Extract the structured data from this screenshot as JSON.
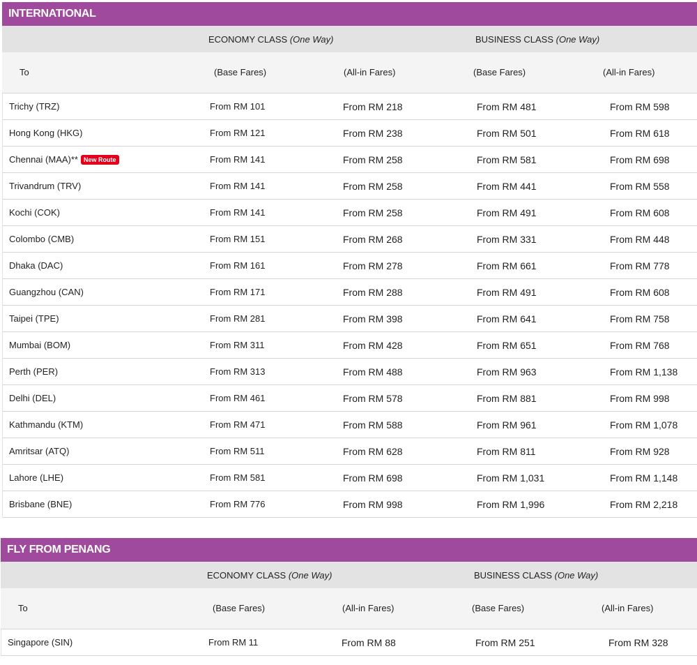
{
  "international": {
    "title": "INTERNATIONAL",
    "economy_label": "ECONOMY CLASS",
    "business_label": "BUSINESS CLASS",
    "one_way": "(One Way)",
    "col_to": "To",
    "col_base": "(Base Fares)",
    "col_allin": "(All-in Fares)",
    "rows": [
      {
        "dest": "Trichy (TRZ)",
        "eco_base": "From RM 101",
        "eco_allin": "From RM 218",
        "bus_base": "From RM 481",
        "bus_allin": "From RM 598"
      },
      {
        "dest": "Hong Kong (HKG)",
        "eco_base": "From RM 121",
        "eco_allin": "From RM 238",
        "bus_base": "From RM 501",
        "bus_allin": "From RM 618"
      },
      {
        "dest": "Chennai (MAA)**",
        "badge": "New Route",
        "eco_base": "From RM 141",
        "eco_allin": "From RM 258",
        "bus_base": "From RM 581",
        "bus_allin": "From RM 698"
      },
      {
        "dest": "Trivandrum (TRV)",
        "eco_base": "From RM 141",
        "eco_allin": "From RM 258",
        "bus_base": "From RM 441",
        "bus_allin": "From RM 558"
      },
      {
        "dest": "Kochi (COK)",
        "eco_base": "From RM 141",
        "eco_allin": "From RM 258",
        "bus_base": "From RM 491",
        "bus_allin": "From RM 608"
      },
      {
        "dest": "Colombo (CMB)",
        "eco_base": "From RM 151",
        "eco_allin": "From RM 268",
        "bus_base": "From RM 331",
        "bus_allin": "From RM 448"
      },
      {
        "dest": "Dhaka (DAC)",
        "eco_base": "From RM 161",
        "eco_allin": "From RM 278",
        "bus_base": "From RM 661",
        "bus_allin": "From RM 778"
      },
      {
        "dest": "Guangzhou (CAN)",
        "eco_base": "From RM 171",
        "eco_allin": "From RM 288",
        "bus_base": "From RM 491",
        "bus_allin": "From RM 608"
      },
      {
        "dest": "Taipei (TPE)",
        "eco_base": "From RM 281",
        "eco_allin": "From RM 398",
        "bus_base": "From RM 641",
        "bus_allin": "From RM 758"
      },
      {
        "dest": "Mumbai (BOM)",
        "eco_base": "From RM 311",
        "eco_allin": "From RM 428",
        "bus_base": "From RM 651",
        "bus_allin": "From RM 768"
      },
      {
        "dest": "Perth (PER)",
        "eco_base": "From RM 313",
        "eco_allin": "From RM 488",
        "bus_base": "From RM 963",
        "bus_allin": "From RM 1,138"
      },
      {
        "dest": "Delhi (DEL)",
        "eco_base": "From RM 461",
        "eco_allin": "From RM 578",
        "bus_base": "From RM 881",
        "bus_allin": "From RM 998"
      },
      {
        "dest": "Kathmandu (KTM)",
        "eco_base": "From RM 471",
        "eco_allin": "From RM 588",
        "bus_base": "From RM 961",
        "bus_allin": "From RM 1,078"
      },
      {
        "dest": "Amritsar (ATQ)",
        "eco_base": "From RM 511",
        "eco_allin": "From RM 628",
        "bus_base": "From RM 811",
        "bus_allin": "From RM 928"
      },
      {
        "dest": "Lahore (LHE)",
        "eco_base": "From RM 581",
        "eco_allin": "From RM 698",
        "bus_base": "From RM 1,031",
        "bus_allin": "From RM 1,148"
      },
      {
        "dest": "Brisbane (BNE)",
        "eco_base": "From RM 776",
        "eco_allin": "From RM 998",
        "bus_base": "From RM 1,996",
        "bus_allin": "From RM 2,218"
      }
    ]
  },
  "penang": {
    "title": "FLY FROM PENANG",
    "economy_label": "ECONOMY CLASS",
    "business_label": "BUSINESS CLASS",
    "one_way": "(One Way)",
    "col_to": "To",
    "col_base": "(Base Fares)",
    "col_allin": "(All-in Fares)",
    "rows": [
      {
        "dest": "Singapore (SIN)",
        "eco_base": "From RM 11",
        "eco_allin": "From RM 88",
        "bus_base": "From RM 251",
        "bus_allin": "From RM 328"
      }
    ]
  },
  "colors": {
    "header_purple": "#a04a9e",
    "badge_red": "#e2001a",
    "class_row_bg": "#e3e3e3"
  }
}
